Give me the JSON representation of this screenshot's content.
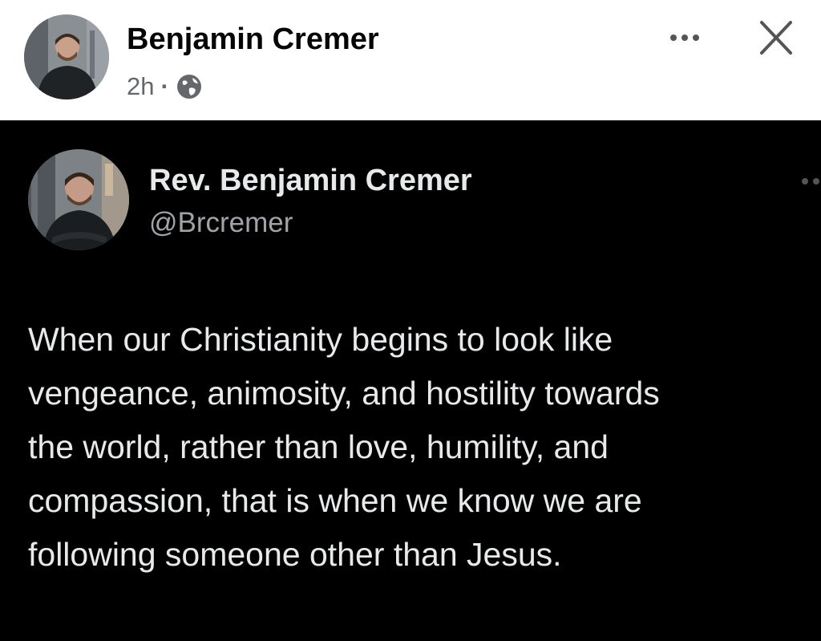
{
  "post": {
    "author": "Benjamin Cremer",
    "time": "2h",
    "separator": "·",
    "audience_icon": "globe-icon",
    "actions": {
      "more_icon": "more-options-icon",
      "close_icon": "close-icon"
    }
  },
  "tweet": {
    "display_name": "Rev. Benjamin Cremer",
    "handle": "@Brcremer",
    "more_icon": "more-options-icon",
    "lines": [
      "When our Christianity begins to look like",
      "vengeance, animosity, and hostility towards",
      "the world, rather than love, humility, and",
      "compassion, that is when we know we are",
      "following someone other than Jesus."
    ]
  },
  "colors": {
    "header_bg": "#ffffff",
    "tweet_bg": "#000000",
    "tweet_text": "#e7e9ea",
    "handle_text": "#a0a4a8",
    "meta_text": "#65676b"
  }
}
